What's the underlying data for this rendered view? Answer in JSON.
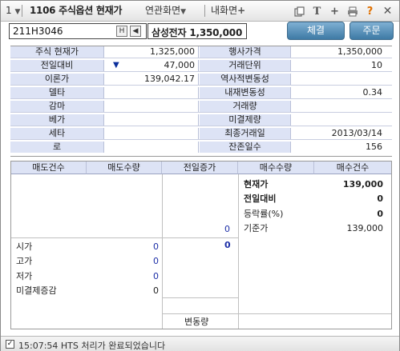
{
  "titlebar": {
    "menu_number": "1",
    "screen_code": "1106 주식옵션 현재가",
    "related_screens": "연관화면",
    "my_screen": "내화면",
    "icons": [
      "copy-icon",
      "text-icon",
      "plus-icon",
      "print-icon",
      "help-icon",
      "close-icon"
    ]
  },
  "search": {
    "code": "211H3046",
    "h_button": "H"
  },
  "name_box": "삼성전자 1,350,000",
  "buttons": {
    "execution": "체결",
    "order": "주문"
  },
  "info_grid": {
    "rows": [
      {
        "label1": "주식 현재가",
        "value1": "1,325,000",
        "label2": "행사가격",
        "value2": "1,350,000"
      },
      {
        "label1": "전일대비",
        "value1": "47,000",
        "label2": "거래단위",
        "value2": "10"
      },
      {
        "label1": "이론가",
        "value1": "139,042.17",
        "label2": "역사적변동성",
        "value2": ""
      },
      {
        "label1": "델타",
        "value1": "",
        "label2": "내재변동성",
        "value2": "0.34"
      },
      {
        "label1": "감마",
        "value1": "",
        "label2": "거래량",
        "value2": ""
      },
      {
        "label1": "베가",
        "value1": "",
        "label2": "미결제량",
        "value2": ""
      },
      {
        "label1": "세타",
        "value1": "",
        "label2": "최종거래일",
        "value2": "2013/03/14"
      },
      {
        "label1": "로",
        "value1": "",
        "label2": "잔존일수",
        "value2": "156"
      }
    ],
    "change_direction": "▼"
  },
  "order_book": {
    "headers": [
      "매도건수",
      "매도수량",
      "전일증가",
      "매수수량",
      "매수건수"
    ],
    "center_zero_1": "0",
    "center_zero_2": "0",
    "right_panel": [
      {
        "label": "현재가",
        "value": "139,000",
        "bold": true
      },
      {
        "label": "전일대비",
        "value": "0",
        "bold": true
      },
      {
        "label": "등락률(%)",
        "value": "0",
        "bold": false
      },
      {
        "label": "기준가",
        "value": "139,000",
        "bold": false
      }
    ],
    "left_panel": [
      {
        "label": "시가",
        "value": "0"
      },
      {
        "label": "고가",
        "value": "0"
      },
      {
        "label": "저가",
        "value": "0"
      },
      {
        "label": "미결제증감",
        "value": "0"
      }
    ],
    "footer_label": "변동량"
  },
  "status": {
    "checked": true,
    "message": "15:07:54  HTS 처리가 완료되었습니다"
  },
  "colors": {
    "label_bg": "#dde3f5",
    "button": "#4f88b3",
    "value_blue": "#1d2fa7"
  }
}
